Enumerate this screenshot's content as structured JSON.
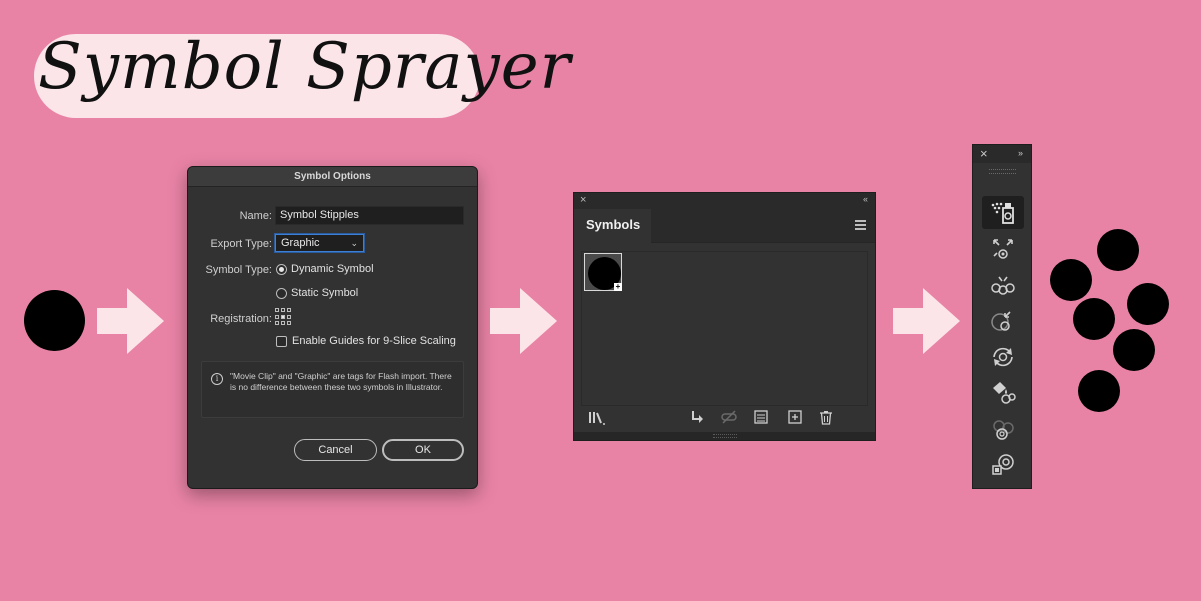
{
  "title": "Symbol Sprayer",
  "colors": {
    "background": "#e983a6",
    "pill": "#fbe5e9",
    "panel": "#323232",
    "accent": "#3d7fd4"
  },
  "symbol_options": {
    "window_title": "Symbol Options",
    "name_label": "Name:",
    "name_value": "Symbol Stipples",
    "export_type_label": "Export Type:",
    "export_type_value": "Graphic",
    "symbol_type_label": "Symbol Type:",
    "dynamic_symbol": "Dynamic Symbol",
    "static_symbol": "Static Symbol",
    "registration_label": "Registration:",
    "nine_slice_label": "Enable Guides for 9-Slice Scaling",
    "info_text": "\"Movie Clip\" and \"Graphic\" are tags for Flash import. There is no difference between these two symbols in Illustrator.",
    "cancel_label": "Cancel",
    "ok_label": "OK"
  },
  "symbols_panel": {
    "tab_label": "Symbols",
    "close_icon": "×",
    "collapse_icon": "‹‹",
    "footer_icons": [
      "libraries-icon",
      "place-symbol-icon",
      "break-link-icon",
      "symbol-options-icon",
      "new-symbol-icon",
      "delete-icon"
    ]
  },
  "toolbar": {
    "close_icon": "×",
    "expand_icon": "››",
    "tools": [
      "symbol-sprayer-tool",
      "symbol-shifter-tool",
      "symbol-scruncher-tool",
      "symbol-sizer-tool",
      "symbol-spinner-tool",
      "symbol-stainer-tool",
      "symbol-screener-tool",
      "symbol-styler-tool"
    ]
  }
}
